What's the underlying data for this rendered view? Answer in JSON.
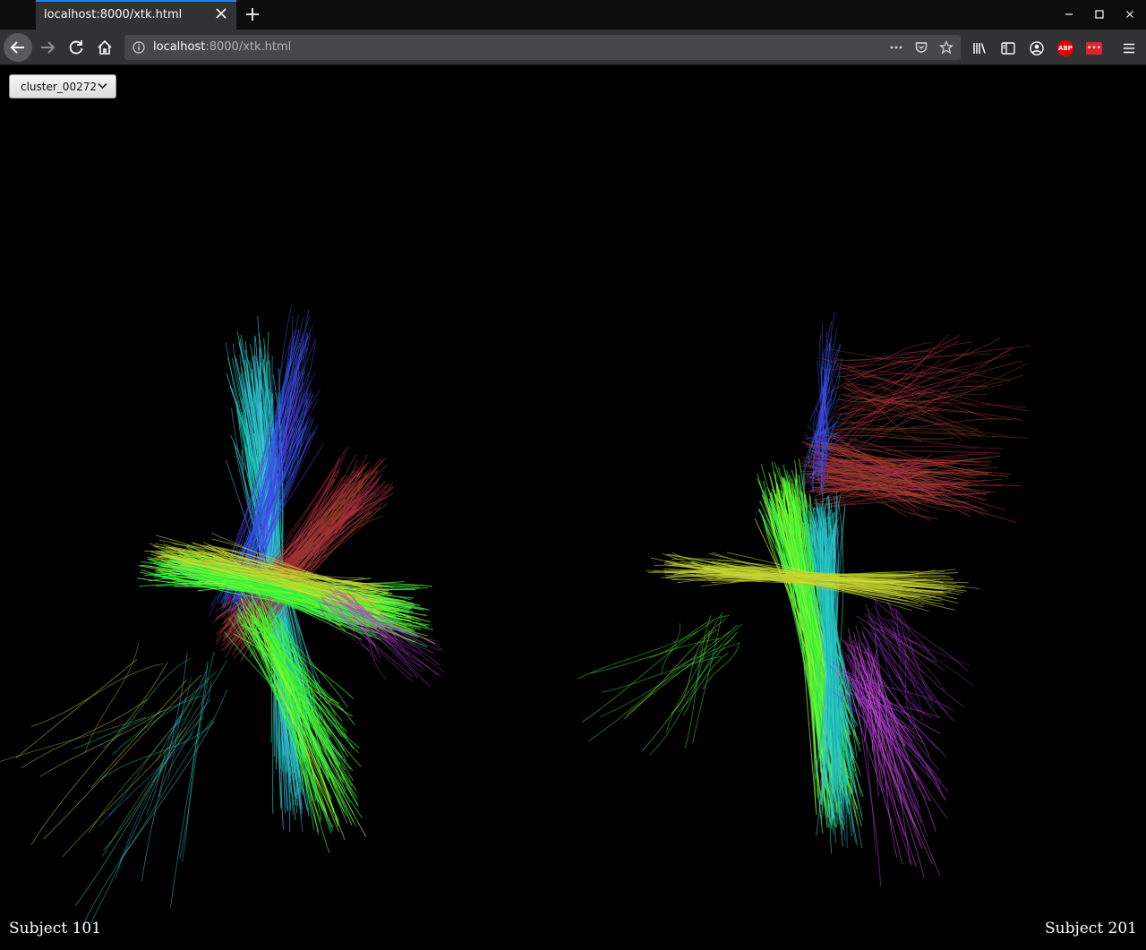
{
  "browser": {
    "tab_title": "localhost:8000/xtk.html",
    "url_host": "localhost",
    "url_rest": ":8000/xtk.html"
  },
  "toolbar": {
    "abp_label": "ABP",
    "ext_label": "•••"
  },
  "viewer": {
    "cluster_select": "cluster_00272",
    "left_label": "Subject 101",
    "right_label": "Subject 201"
  }
}
